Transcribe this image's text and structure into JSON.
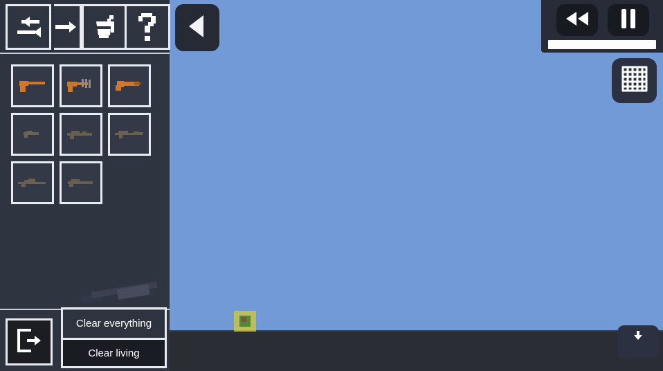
{
  "world": {
    "sky_color": "#729AD6",
    "ground_color": "#2A2D33",
    "object": {
      "name": "spawned-crate",
      "body_color": "#C8C447",
      "core_color": "#4E8A3C"
    }
  },
  "sidebar": {
    "background": "#2E3440",
    "toolbar": {
      "buttons": [
        {
          "id": "swap",
          "icon": "swap-arrows-icon",
          "label": "Swap"
        },
        {
          "id": "overflow-arrow",
          "icon": "arrow-right-icon",
          "label": "Next"
        },
        {
          "id": "paint",
          "icon": "paint-bucket-icon",
          "label": "Paint"
        },
        {
          "id": "help",
          "icon": "question-mark-icon",
          "label": "Help"
        }
      ]
    },
    "inventory": {
      "slots": [
        {
          "index": 0,
          "icon": "pistol-icon",
          "tint": "#D4762A",
          "kind": "pistol"
        },
        {
          "index": 1,
          "icon": "smg-icon",
          "tint": "#C9762F",
          "kind": "smg"
        },
        {
          "index": 2,
          "icon": "sawed-off-icon",
          "tint": "#D4762A",
          "kind": "shotgun"
        },
        {
          "index": 3,
          "icon": "rifle-icon",
          "tint": "#6E6250",
          "kind": "rifle"
        },
        {
          "index": 4,
          "icon": "carbine-icon",
          "tint": "#6A5F4F",
          "kind": "carbine"
        },
        {
          "index": 5,
          "icon": "assault-rifle-icon",
          "tint": "#6C6150",
          "kind": "assault-rifle"
        },
        {
          "index": 6,
          "icon": "sniper-icon",
          "tint": "#6B6050",
          "kind": "sniper"
        },
        {
          "index": 7,
          "icon": "shotgun-long-icon",
          "tint": "#6A5F4E",
          "kind": "shotgun-long"
        }
      ]
    },
    "equipped": {
      "icon": "rocket-launcher-icon",
      "label": ""
    },
    "bottom": {
      "exit": {
        "icon": "exit-door-icon",
        "label": "Exit"
      },
      "clear_everything": "Clear everything",
      "clear_living": "Clear living"
    }
  },
  "overlay": {
    "back": {
      "icon": "triangle-left-icon",
      "label": "Back"
    },
    "playback": {
      "rewind": {
        "icon": "rewind-icon",
        "label": "Rewind"
      },
      "pause": {
        "icon": "pause-icon",
        "label": "Pause"
      },
      "slider_value": "100",
      "slider_color": "#FFFFFF"
    },
    "grid_toggle": {
      "icon": "grid-icon",
      "label": "Grid"
    },
    "download": {
      "icon": "download-icon",
      "label": "Save"
    }
  }
}
